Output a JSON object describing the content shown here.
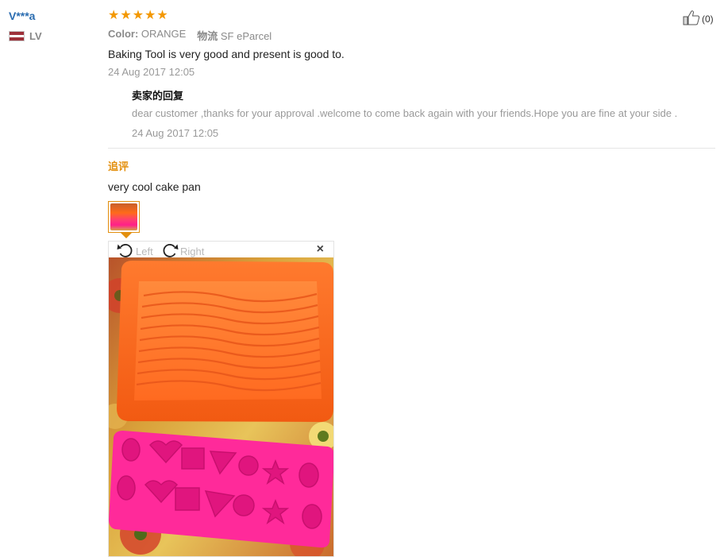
{
  "buyer": {
    "name": "V***a",
    "country": "LV"
  },
  "review": {
    "stars": [
      "★",
      "★",
      "★",
      "★",
      "★"
    ],
    "helpful_count": "(0)",
    "color_key": "Color:",
    "color_value": "ORANGE",
    "shipping_key": "物流",
    "shipping_value": "SF eParcel",
    "text": "Baking Tool is very good and present is good to.",
    "date": "24 Aug 2017 12:05"
  },
  "seller_reply": {
    "title": "卖家的回复",
    "text": "dear customer ,thanks for your approval .welcome to come back again with your friends.Hope you are fine at your side .",
    "date": "24 Aug 2017 12:05"
  },
  "additional_feedback": {
    "title": "追评",
    "text": "very cool cake pan"
  },
  "image_viewer": {
    "rotate_left_label": "Left",
    "rotate_right_label": "Right",
    "close_symbol": "×"
  },
  "icons": {
    "thumb_up": "thumbs-up-icon",
    "rotate_left": "rotate-left-icon",
    "rotate_right": "rotate-right-icon",
    "close": "close-icon",
    "flag": "latvia-flag-icon"
  },
  "colors": {
    "star": "#f39800",
    "buyer_name": "#2a6cb0",
    "additional_title": "#e3900f"
  }
}
